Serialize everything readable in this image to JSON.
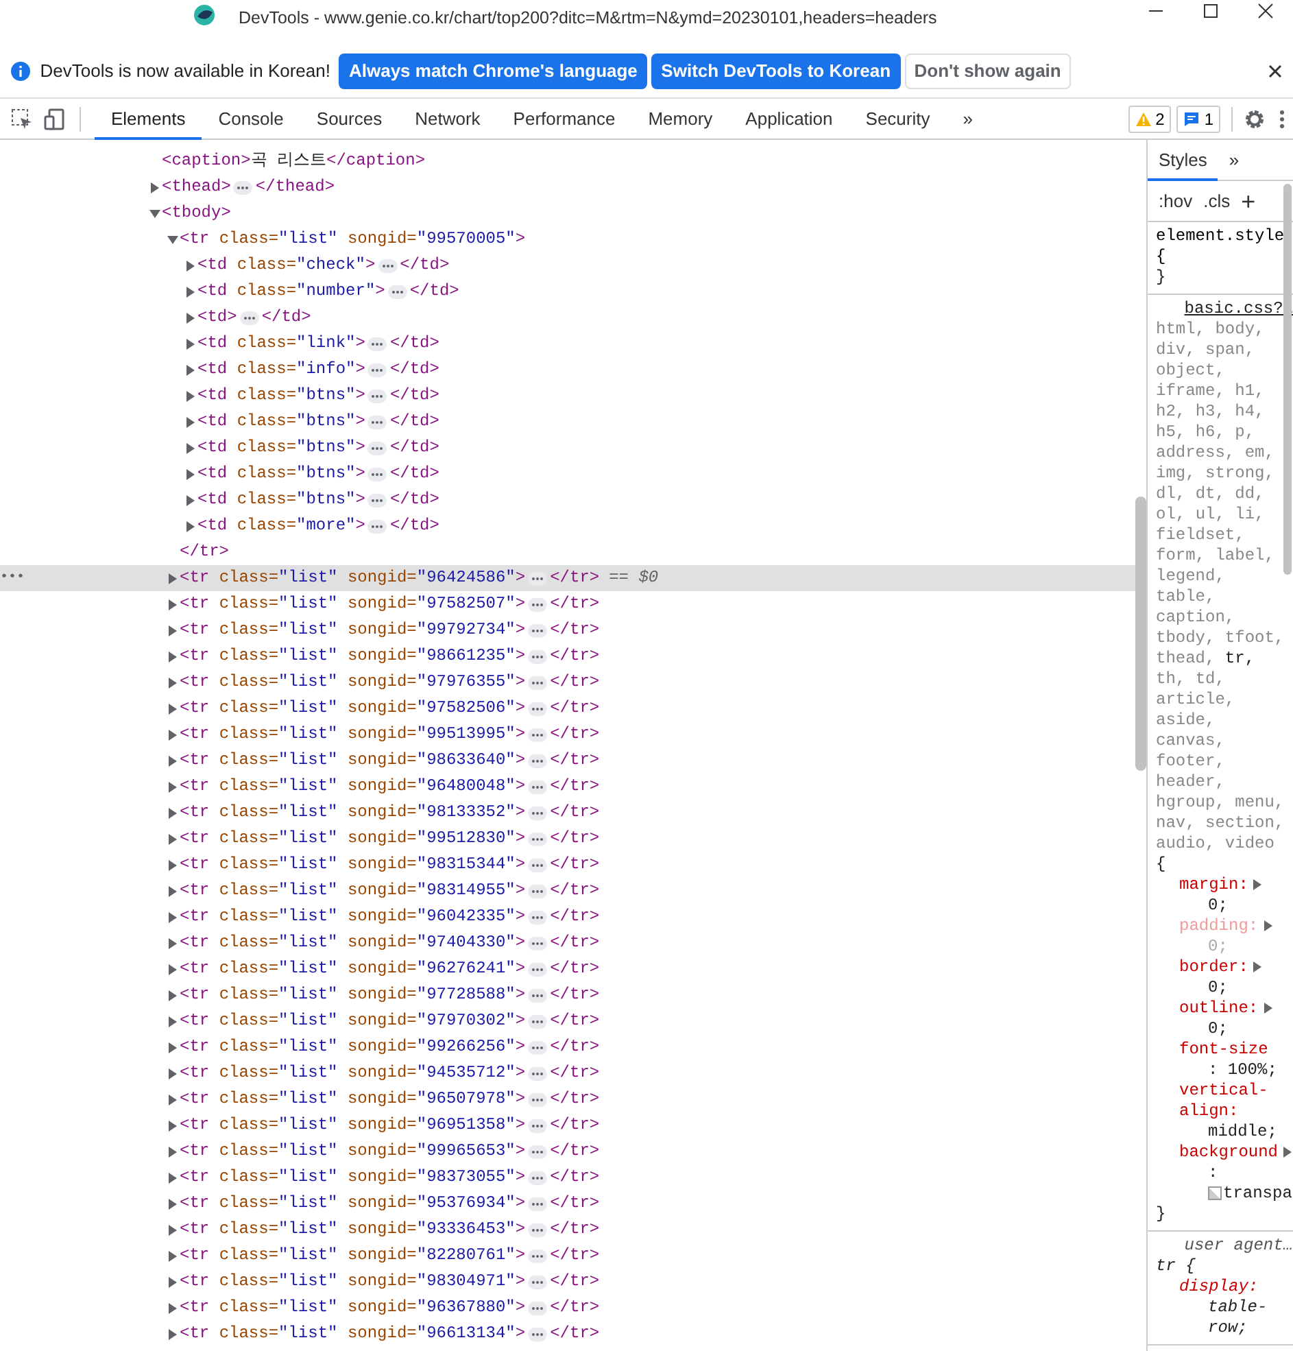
{
  "window": {
    "title": "DevTools - www.genie.co.kr/chart/top200?ditc=M&rtm=N&ymd=20230101,headers=headers"
  },
  "infobar": {
    "message": "DevTools is now available in Korean!",
    "buttons": [
      {
        "label": "Always match Chrome's language",
        "kind": "primary"
      },
      {
        "label": "Switch DevTools to Korean",
        "kind": "primary"
      },
      {
        "label": "Don't show again",
        "kind": "secondary"
      }
    ]
  },
  "toolbar": {
    "tabs": [
      {
        "label": "Elements",
        "selected": true
      },
      {
        "label": "Console",
        "selected": false
      },
      {
        "label": "Sources",
        "selected": false
      },
      {
        "label": "Network",
        "selected": false
      },
      {
        "label": "Performance",
        "selected": false
      },
      {
        "label": "Memory",
        "selected": false
      },
      {
        "label": "Application",
        "selected": false
      },
      {
        "label": "Security",
        "selected": false
      }
    ],
    "more": "»",
    "warnings": "2",
    "messages": "1"
  },
  "elements": {
    "nodes": [
      {
        "open": "<caption>",
        "text": "곡 리스트",
        "close": "</caption>"
      },
      {
        "open": "<thead",
        "open_end": ">",
        "expanded": false,
        "close": "</thead>"
      },
      {
        "open": "<tbody",
        "open_end": ">",
        "expanded": true,
        "children": [
          {
            "open": "<tr",
            "attrs": [
              {
                "name": "class=",
                "value": "\"list\""
              },
              {
                "name": "songid=",
                "value": "\"99570005\""
              }
            ],
            "open_end": ">",
            "expanded": true,
            "selected": false,
            "close": "</tr>",
            "children": [
              {
                "open": "<td",
                "attrs": [
                  {
                    "name": "class=",
                    "value": "\"check\""
                  }
                ],
                "open_end": ">",
                "expanded": false,
                "close": "</td>"
              },
              {
                "open": "<td",
                "attrs": [
                  {
                    "name": "class=",
                    "value": "\"number\""
                  }
                ],
                "open_end": ">",
                "expanded": false,
                "close": "</td>"
              },
              {
                "open": "<td",
                "open_end": ">",
                "expanded": false,
                "close": "</td>"
              },
              {
                "open": "<td",
                "attrs": [
                  {
                    "name": "class=",
                    "value": "\"link\""
                  }
                ],
                "open_end": ">",
                "expanded": false,
                "close": "</td>"
              },
              {
                "open": "<td",
                "attrs": [
                  {
                    "name": "class=",
                    "value": "\"info\""
                  }
                ],
                "open_end": ">",
                "expanded": false,
                "close": "</td>"
              },
              {
                "open": "<td",
                "attrs": [
                  {
                    "name": "class=",
                    "value": "\"btns\""
                  }
                ],
                "open_end": ">",
                "expanded": false,
                "close": "</td>"
              },
              {
                "open": "<td",
                "attrs": [
                  {
                    "name": "class=",
                    "value": "\"btns\""
                  }
                ],
                "open_end": ">",
                "expanded": false,
                "close": "</td>"
              },
              {
                "open": "<td",
                "attrs": [
                  {
                    "name": "class=",
                    "value": "\"btns\""
                  }
                ],
                "open_end": ">",
                "expanded": false,
                "close": "</td>"
              },
              {
                "open": "<td",
                "attrs": [
                  {
                    "name": "class=",
                    "value": "\"btns\""
                  }
                ],
                "open_end": ">",
                "expanded": false,
                "close": "</td>"
              },
              {
                "open": "<td",
                "attrs": [
                  {
                    "name": "class=",
                    "value": "\"btns\""
                  }
                ],
                "open_end": ">",
                "expanded": false,
                "close": "</td>"
              },
              {
                "open": "<td",
                "attrs": [
                  {
                    "name": "class=",
                    "value": "\"more\""
                  }
                ],
                "open_end": ">",
                "expanded": false,
                "close": "</td>"
              }
            ]
          },
          {
            "open": "<tr",
            "attrs": [
              {
                "name": "class=",
                "value": "\"list\""
              },
              {
                "name": "songid=",
                "value": "\"96424586\""
              }
            ],
            "open_end": ">",
            "expanded": false,
            "selected": true,
            "close": "</tr>",
            "marker": "== $0",
            "gutter": "•••"
          },
          {
            "open": "<tr",
            "attrs": [
              {
                "name": "class=",
                "value": "\"list\""
              },
              {
                "name": "songid=",
                "value": "\"97582507\""
              }
            ],
            "open_end": ">",
            "expanded": false,
            "selected": false,
            "close": "</tr>"
          },
          {
            "open": "<tr",
            "attrs": [
              {
                "name": "class=",
                "value": "\"list\""
              },
              {
                "name": "songid=",
                "value": "\"99792734\""
              }
            ],
            "open_end": ">",
            "expanded": false,
            "selected": false,
            "close": "</tr>"
          },
          {
            "open": "<tr",
            "attrs": [
              {
                "name": "class=",
                "value": "\"list\""
              },
              {
                "name": "songid=",
                "value": "\"98661235\""
              }
            ],
            "open_end": ">",
            "expanded": false,
            "selected": false,
            "close": "</tr>"
          },
          {
            "open": "<tr",
            "attrs": [
              {
                "name": "class=",
                "value": "\"list\""
              },
              {
                "name": "songid=",
                "value": "\"97976355\""
              }
            ],
            "open_end": ">",
            "expanded": false,
            "selected": false,
            "close": "</tr>"
          },
          {
            "open": "<tr",
            "attrs": [
              {
                "name": "class=",
                "value": "\"list\""
              },
              {
                "name": "songid=",
                "value": "\"97582506\""
              }
            ],
            "open_end": ">",
            "expanded": false,
            "selected": false,
            "close": "</tr>"
          },
          {
            "open": "<tr",
            "attrs": [
              {
                "name": "class=",
                "value": "\"list\""
              },
              {
                "name": "songid=",
                "value": "\"99513995\""
              }
            ],
            "open_end": ">",
            "expanded": false,
            "selected": false,
            "close": "</tr>"
          },
          {
            "open": "<tr",
            "attrs": [
              {
                "name": "class=",
                "value": "\"list\""
              },
              {
                "name": "songid=",
                "value": "\"98633640\""
              }
            ],
            "open_end": ">",
            "expanded": false,
            "selected": false,
            "close": "</tr>"
          },
          {
            "open": "<tr",
            "attrs": [
              {
                "name": "class=",
                "value": "\"list\""
              },
              {
                "name": "songid=",
                "value": "\"96480048\""
              }
            ],
            "open_end": ">",
            "expanded": false,
            "selected": false,
            "close": "</tr>"
          },
          {
            "open": "<tr",
            "attrs": [
              {
                "name": "class=",
                "value": "\"list\""
              },
              {
                "name": "songid=",
                "value": "\"98133352\""
              }
            ],
            "open_end": ">",
            "expanded": false,
            "selected": false,
            "close": "</tr>"
          },
          {
            "open": "<tr",
            "attrs": [
              {
                "name": "class=",
                "value": "\"list\""
              },
              {
                "name": "songid=",
                "value": "\"99512830\""
              }
            ],
            "open_end": ">",
            "expanded": false,
            "selected": false,
            "close": "</tr>"
          },
          {
            "open": "<tr",
            "attrs": [
              {
                "name": "class=",
                "value": "\"list\""
              },
              {
                "name": "songid=",
                "value": "\"98315344\""
              }
            ],
            "open_end": ">",
            "expanded": false,
            "selected": false,
            "close": "</tr>"
          },
          {
            "open": "<tr",
            "attrs": [
              {
                "name": "class=",
                "value": "\"list\""
              },
              {
                "name": "songid=",
                "value": "\"98314955\""
              }
            ],
            "open_end": ">",
            "expanded": false,
            "selected": false,
            "close": "</tr>"
          },
          {
            "open": "<tr",
            "attrs": [
              {
                "name": "class=",
                "value": "\"list\""
              },
              {
                "name": "songid=",
                "value": "\"96042335\""
              }
            ],
            "open_end": ">",
            "expanded": false,
            "selected": false,
            "close": "</tr>"
          },
          {
            "open": "<tr",
            "attrs": [
              {
                "name": "class=",
                "value": "\"list\""
              },
              {
                "name": "songid=",
                "value": "\"97404330\""
              }
            ],
            "open_end": ">",
            "expanded": false,
            "selected": false,
            "close": "</tr>"
          },
          {
            "open": "<tr",
            "attrs": [
              {
                "name": "class=",
                "value": "\"list\""
              },
              {
                "name": "songid=",
                "value": "\"96276241\""
              }
            ],
            "open_end": ">",
            "expanded": false,
            "selected": false,
            "close": "</tr>"
          },
          {
            "open": "<tr",
            "attrs": [
              {
                "name": "class=",
                "value": "\"list\""
              },
              {
                "name": "songid=",
                "value": "\"97728588\""
              }
            ],
            "open_end": ">",
            "expanded": false,
            "selected": false,
            "close": "</tr>"
          },
          {
            "open": "<tr",
            "attrs": [
              {
                "name": "class=",
                "value": "\"list\""
              },
              {
                "name": "songid=",
                "value": "\"97970302\""
              }
            ],
            "open_end": ">",
            "expanded": false,
            "selected": false,
            "close": "</tr>"
          },
          {
            "open": "<tr",
            "attrs": [
              {
                "name": "class=",
                "value": "\"list\""
              },
              {
                "name": "songid=",
                "value": "\"99266256\""
              }
            ],
            "open_end": ">",
            "expanded": false,
            "selected": false,
            "close": "</tr>"
          },
          {
            "open": "<tr",
            "attrs": [
              {
                "name": "class=",
                "value": "\"list\""
              },
              {
                "name": "songid=",
                "value": "\"94535712\""
              }
            ],
            "open_end": ">",
            "expanded": false,
            "selected": false,
            "close": "</tr>"
          },
          {
            "open": "<tr",
            "attrs": [
              {
                "name": "class=",
                "value": "\"list\""
              },
              {
                "name": "songid=",
                "value": "\"96507978\""
              }
            ],
            "open_end": ">",
            "expanded": false,
            "selected": false,
            "close": "</tr>"
          },
          {
            "open": "<tr",
            "attrs": [
              {
                "name": "class=",
                "value": "\"list\""
              },
              {
                "name": "songid=",
                "value": "\"96951358\""
              }
            ],
            "open_end": ">",
            "expanded": false,
            "selected": false,
            "close": "</tr>"
          },
          {
            "open": "<tr",
            "attrs": [
              {
                "name": "class=",
                "value": "\"list\""
              },
              {
                "name": "songid=",
                "value": "\"99965653\""
              }
            ],
            "open_end": ">",
            "expanded": false,
            "selected": false,
            "close": "</tr>"
          },
          {
            "open": "<tr",
            "attrs": [
              {
                "name": "class=",
                "value": "\"list\""
              },
              {
                "name": "songid=",
                "value": "\"98373055\""
              }
            ],
            "open_end": ">",
            "expanded": false,
            "selected": false,
            "close": "</tr>"
          },
          {
            "open": "<tr",
            "attrs": [
              {
                "name": "class=",
                "value": "\"list\""
              },
              {
                "name": "songid=",
                "value": "\"95376934\""
              }
            ],
            "open_end": ">",
            "expanded": false,
            "selected": false,
            "close": "</tr>"
          },
          {
            "open": "<tr",
            "attrs": [
              {
                "name": "class=",
                "value": "\"list\""
              },
              {
                "name": "songid=",
                "value": "\"93336453\""
              }
            ],
            "open_end": ">",
            "expanded": false,
            "selected": false,
            "close": "</tr>"
          },
          {
            "open": "<tr",
            "attrs": [
              {
                "name": "class=",
                "value": "\"list\""
              },
              {
                "name": "songid=",
                "value": "\"82280761\""
              }
            ],
            "open_end": ">",
            "expanded": false,
            "selected": false,
            "close": "</tr>"
          },
          {
            "open": "<tr",
            "attrs": [
              {
                "name": "class=",
                "value": "\"list\""
              },
              {
                "name": "songid=",
                "value": "\"98304971\""
              }
            ],
            "open_end": ">",
            "expanded": false,
            "selected": false,
            "close": "</tr>"
          },
          {
            "open": "<tr",
            "attrs": [
              {
                "name": "class=",
                "value": "\"list\""
              },
              {
                "name": "songid=",
                "value": "\"96367880\""
              }
            ],
            "open_end": ">",
            "expanded": false,
            "selected": false,
            "close": "</tr>"
          },
          {
            "open": "<tr",
            "attrs": [
              {
                "name": "class=",
                "value": "\"list\""
              },
              {
                "name": "songid=",
                "value": "\"96613134\""
              }
            ],
            "open_end": ">",
            "expanded": false,
            "selected": false,
            "close": "</tr>"
          }
        ]
      }
    ]
  },
  "styles": {
    "tabs": [
      {
        "label": "Styles",
        "selected": true
      }
    ],
    "more": "»",
    "filters": [
      ":hov",
      ".cls"
    ],
    "add": "+",
    "rules": [
      {
        "kind": "inline",
        "selector": [
          {
            "text": "element.style",
            "matched": true
          }
        ],
        "open": "{",
        "close": "}"
      },
      {
        "kind": "author",
        "source": "basic.css?…",
        "selector": [
          {
            "text": "html,",
            "matched": false
          },
          {
            "text": "body,",
            "matched": false
          },
          {
            "text": "div,",
            "matched": false
          },
          {
            "text": "span,",
            "matched": false
          },
          {
            "text": "object,",
            "matched": false
          },
          {
            "text": "iframe,",
            "matched": false
          },
          {
            "text": "h1,",
            "matched": false
          },
          {
            "text": "h2,",
            "matched": false
          },
          {
            "text": "h3,",
            "matched": false
          },
          {
            "text": "h4,",
            "matched": false
          },
          {
            "text": "h5,",
            "matched": false
          },
          {
            "text": "h6,",
            "matched": false
          },
          {
            "text": "p,",
            "matched": false
          },
          {
            "text": "address,",
            "matched": false
          },
          {
            "text": "em,",
            "matched": false
          },
          {
            "text": "img,",
            "matched": false
          },
          {
            "text": "strong,",
            "matched": false
          },
          {
            "text": "dl,",
            "matched": false
          },
          {
            "text": "dt,",
            "matched": false
          },
          {
            "text": "dd,",
            "matched": false
          },
          {
            "text": "ol,",
            "matched": false
          },
          {
            "text": "ul,",
            "matched": false
          },
          {
            "text": "li,",
            "matched": false
          },
          {
            "text": "fieldset,",
            "matched": false
          },
          {
            "text": "form,",
            "matched": false
          },
          {
            "text": "label,",
            "matched": false
          },
          {
            "text": "legend,",
            "matched": false
          },
          {
            "text": "table,",
            "matched": false
          },
          {
            "text": "caption,",
            "matched": false
          },
          {
            "text": "tbody,",
            "matched": false
          },
          {
            "text": "tfoot,",
            "matched": false
          },
          {
            "text": "thead,",
            "matched": false
          },
          {
            "text": "tr,",
            "matched": true
          },
          {
            "text": "th,",
            "matched": false
          },
          {
            "text": "td,",
            "matched": false
          },
          {
            "text": "article,",
            "matched": false
          },
          {
            "text": "aside,",
            "matched": false
          },
          {
            "text": "canvas,",
            "matched": false
          },
          {
            "text": "footer,",
            "matched": false
          },
          {
            "text": "header,",
            "matched": false
          },
          {
            "text": "hgroup,",
            "matched": false
          },
          {
            "text": "menu,",
            "matched": false
          },
          {
            "text": "nav,",
            "matched": false
          },
          {
            "text": "section,",
            "matched": false
          },
          {
            "text": "audio,",
            "matched": false
          },
          {
            "text": "video",
            "matched": false
          }
        ],
        "open": "{",
        "close": "}",
        "properties": [
          {
            "name": "margin:",
            "value": "0;",
            "expandable": true,
            "inactive": false
          },
          {
            "name": "padding:",
            "value": "0;",
            "expandable": true,
            "inactive": true
          },
          {
            "name": "border:",
            "value": "0;",
            "expandable": true,
            "inactive": false
          },
          {
            "name": "outline:",
            "value": "0;",
            "expandable": true,
            "inactive": false
          },
          {
            "name": "font-size",
            "value": ": 100%;",
            "expandable": false,
            "inactive": false
          },
          {
            "name": "vertical-align:",
            "value": "middle;",
            "expandable": false,
            "inactive": false
          },
          {
            "name": "background",
            "value": ":",
            "expandable": true,
            "inactive": false,
            "swatch": "transpa"
          }
        ]
      },
      {
        "kind": "user-agent",
        "source": "user agent…",
        "selector": [
          {
            "text": "tr",
            "matched": true
          }
        ],
        "open": "{",
        "properties": [
          {
            "name": "display:",
            "value": "table-row;",
            "expandable": false,
            "inactive": false
          }
        ]
      }
    ]
  }
}
